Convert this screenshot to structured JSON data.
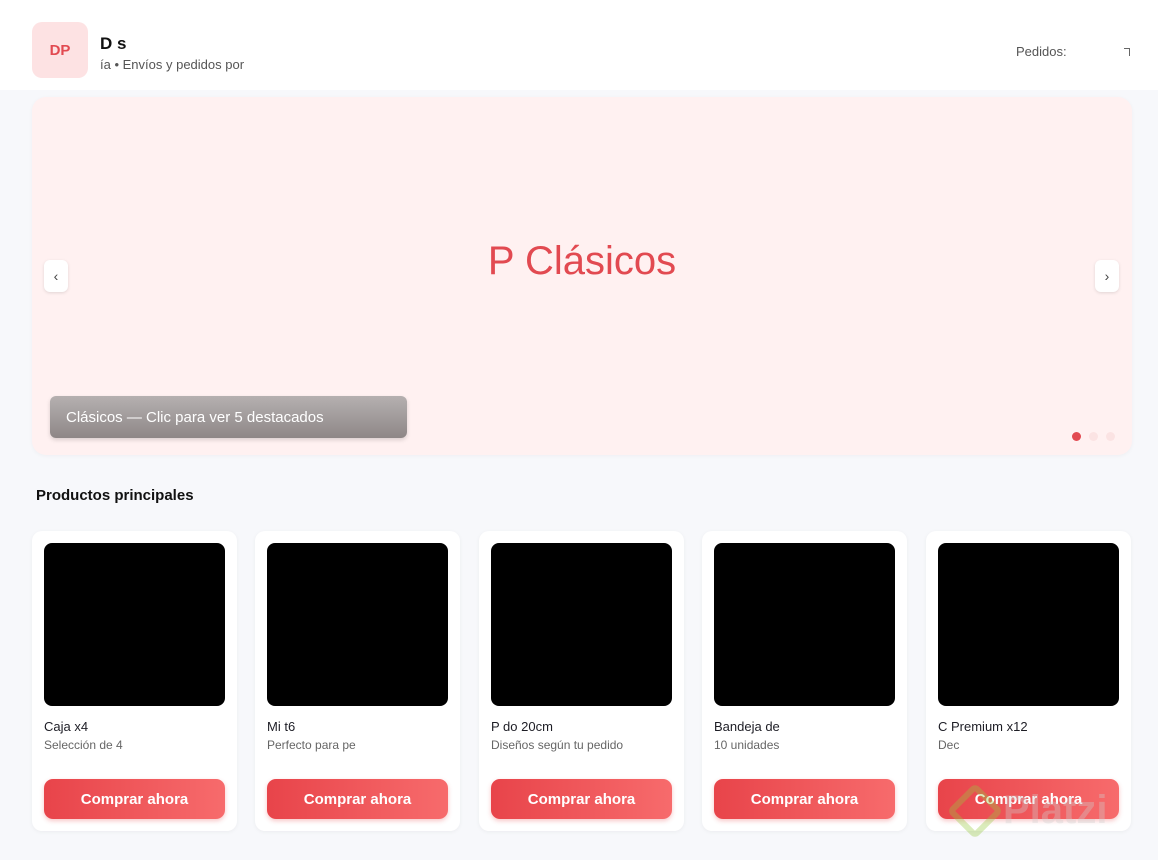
{
  "header": {
    "logo": "DP",
    "store_name": "D       s",
    "tagline": "ía           • Envíos y pedidos por",
    "orders_label": "Pedidos:"
  },
  "banner": {
    "title": "P                  Clásicos",
    "prev": "‹",
    "next": "›",
    "caption": "           Clásicos — Clic para ver 5 destacados",
    "dots": 3,
    "active_dot": 0
  },
  "products": {
    "section_title": "Productos principales",
    "buy_label": "Comprar ahora",
    "items": [
      {
        "name": "Caja                        x4",
        "desc": "Selección de 4"
      },
      {
        "name": "Mi                              t6",
        "desc": "Perfecto para         pe"
      },
      {
        "name": "P                           do 20cm",
        "desc": "Diseños según tu pedido"
      },
      {
        "name": "Bandeja de",
        "desc": "10 unidades"
      },
      {
        "name": "C              Premium x12",
        "desc": "Dec"
      }
    ]
  },
  "watermark": "Platzi"
}
